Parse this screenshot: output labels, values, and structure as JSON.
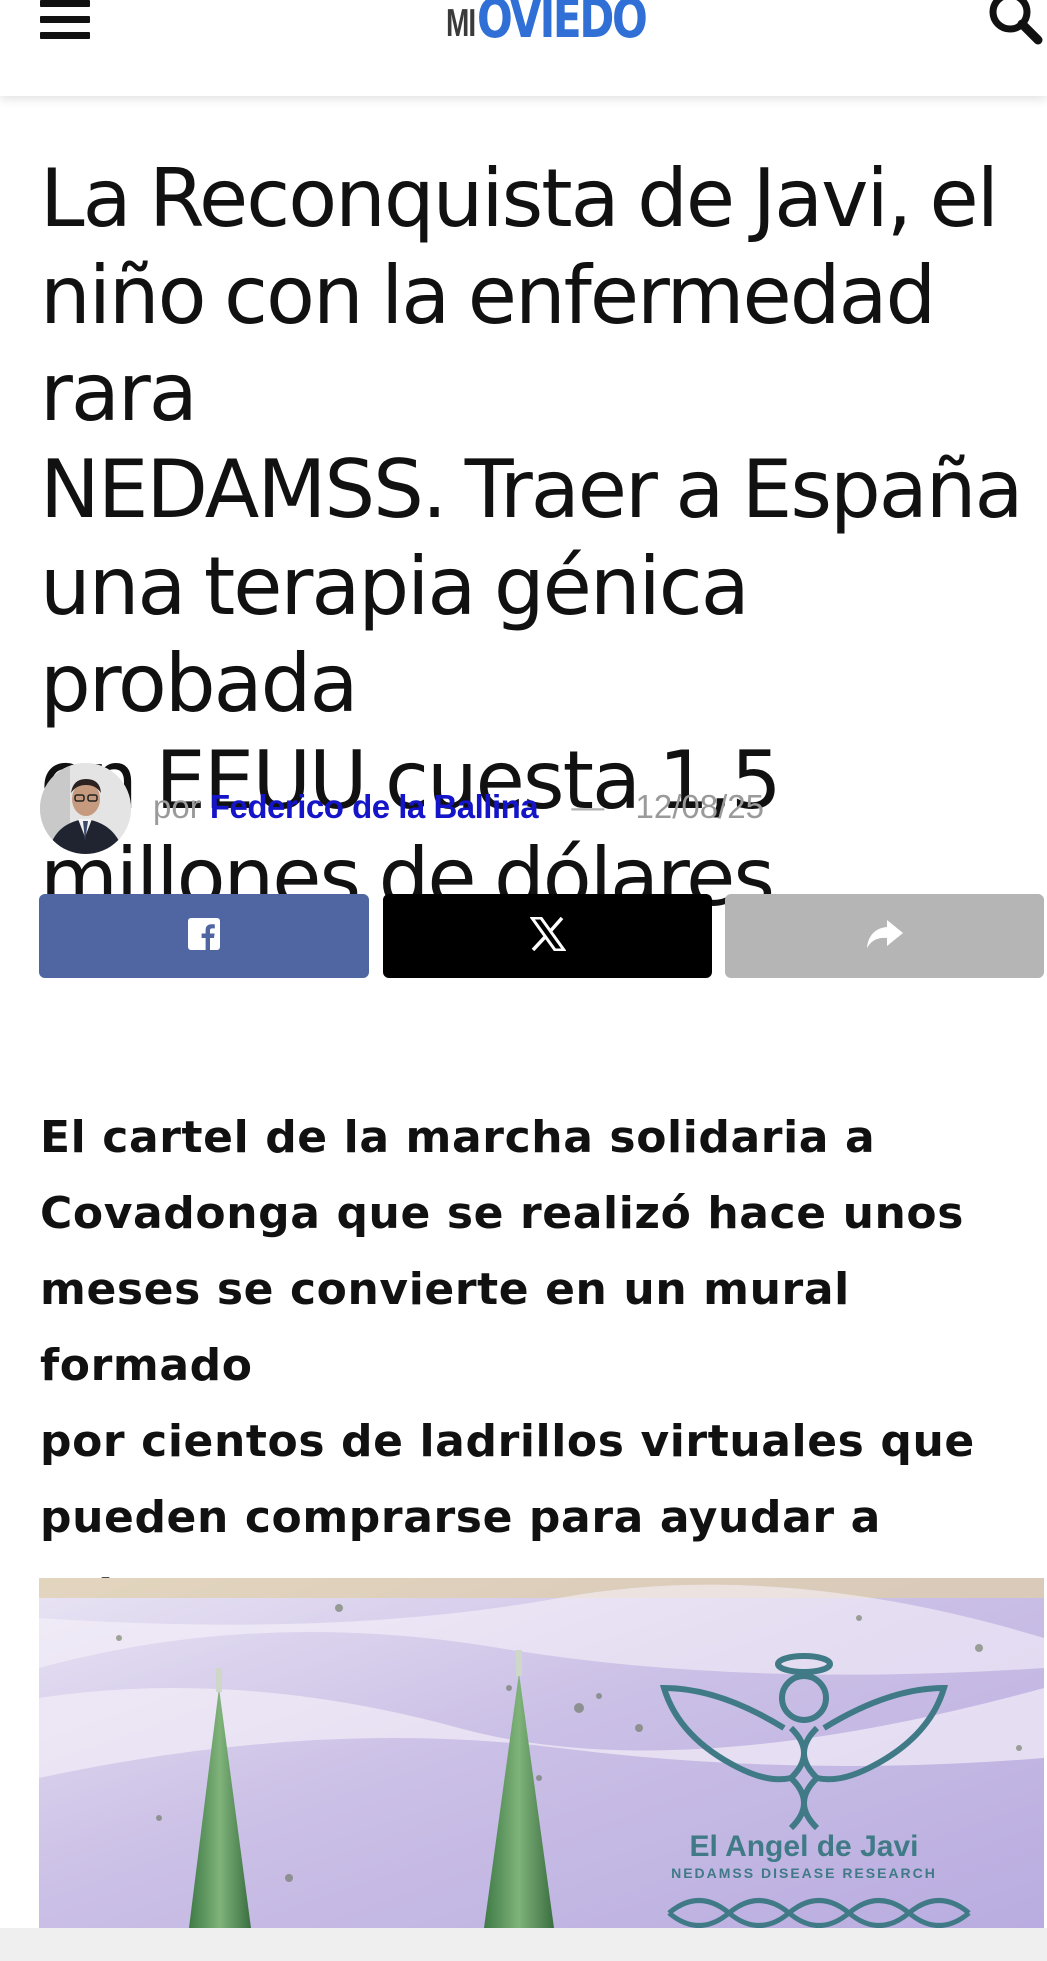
{
  "header": {
    "logo_prefix": "MI",
    "logo_name": "OVIEDO",
    "menu_icon": "hamburger-menu-icon",
    "search_icon": "search-icon",
    "brand_color": "#2f6fd6"
  },
  "article": {
    "title": "La Reconquista de Javi, el\nniño con la enfermedad rara\nNEDAMSS. Traer a España\nuna terapia génica probada\nen EEUU cuesta 1,5\nmillones de dólares",
    "byline": {
      "prefix": "por",
      "author": "Federico de la Ballina",
      "separator": "—",
      "date": "12/08/25",
      "author_color": "#1414c8"
    },
    "share": {
      "facebook_icon": "facebook-icon",
      "x_icon": "x-logo-icon",
      "share_icon": "share-arrow-icon",
      "facebook_color": "#4f66a2",
      "x_color": "#000000",
      "more_color": "#b5b5b5"
    },
    "subtitle": "El cartel de la marcha solidaria a\nCovadonga que se realizó hace unos\nmeses se convierte en un mural formado\npor cientos de ladrillos virtuales que\npueden comprarse para ayudar a estos\npacientes",
    "image": {
      "logo_title": "El Angel de Javi",
      "logo_subtitle": "NEDAMSS DISEASE RESEARCH"
    }
  }
}
